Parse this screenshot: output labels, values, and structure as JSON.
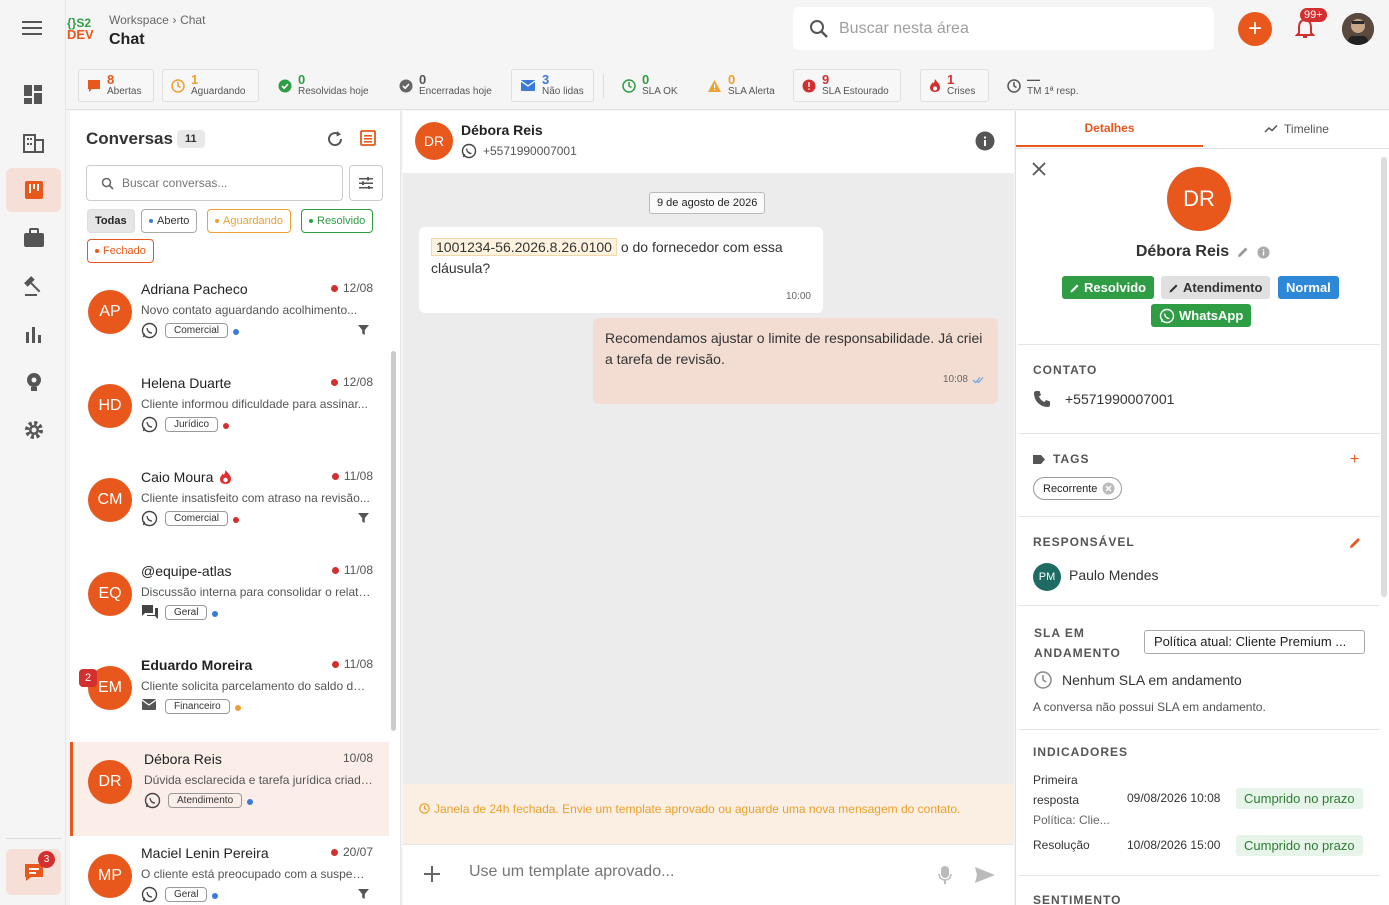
{
  "brand": {
    "logo_line1": "{}S2",
    "logo_line2": "DEV"
  },
  "header": {
    "breadcrumb_root": "Workspace",
    "breadcrumb_sep": "›",
    "breadcrumb_current": "Chat",
    "title": "Chat",
    "search_placeholder": "Buscar nesta área",
    "notif_count": "99+"
  },
  "rail": {
    "chat_badge": "3"
  },
  "stats": [
    {
      "num": "8",
      "label": "Abertas",
      "color": "#e8581c"
    },
    {
      "num": "1",
      "label": "Aguardando",
      "color": "#f0a030"
    },
    {
      "num": "0",
      "label": "Resolvidas hoje",
      "color": "#2e9d44"
    },
    {
      "num": "0",
      "label": "Encerradas hoje",
      "color": "#555555"
    },
    {
      "num": "3",
      "label": "Não lidas",
      "color": "#3a7bd5"
    },
    {
      "num": "0",
      "label": "SLA OK",
      "color": "#2e9d44"
    },
    {
      "num": "0",
      "label": "SLA Alerta",
      "color": "#f0a030"
    },
    {
      "num": "9",
      "label": "SLA Estourado",
      "color": "#d32f2f"
    },
    {
      "num": "1",
      "label": "Crises",
      "color": "#d32f2f"
    },
    {
      "num": "—",
      "label": "TM 1ª resp.",
      "color": "#555555"
    }
  ],
  "conversations": {
    "title": "Conversas",
    "count": "11",
    "search_placeholder": "Buscar conversas...",
    "filters": [
      "Todas",
      "Aberto",
      "Aguardando",
      "Resolvido",
      "Fechado"
    ],
    "items": [
      {
        "initials": "AP",
        "name": "Adriana Pacheco",
        "date": "12/08",
        "preview": "Novo contato aguardando acolhimento...",
        "tag": "Comercial",
        "dot": "#3a7bd5",
        "channel": "whatsapp"
      },
      {
        "initials": "HD",
        "name": "Helena Duarte",
        "date": "12/08",
        "preview": "Cliente informou dificuldade para assinar...",
        "tag": "Jurídico",
        "dot": "#d32f2f",
        "channel": "whatsapp"
      },
      {
        "initials": "CM",
        "name": "Caio Moura",
        "date": "11/08",
        "preview": "Cliente insatisfeito com atraso na revisão...",
        "tag": "Comercial",
        "dot": "#d32f2f",
        "channel": "whatsapp"
      },
      {
        "initials": "EQ",
        "name": "@equipe-atlas",
        "date": "11/08",
        "preview": "Discussão interna para consolidar o relatório...",
        "tag": "Geral",
        "dot": "#3a7bd5",
        "channel": "forum"
      },
      {
        "initials": "EM",
        "name": "Eduardo Moreira",
        "date": "11/08",
        "preview": "Cliente solicita parcelamento do saldo devedor...",
        "tag": "Financeiro",
        "dot": "#f0a030",
        "channel": "email",
        "unread": "2"
      },
      {
        "initials": "DR",
        "name": "Débora Reis",
        "date": "10/08",
        "preview": "Dúvida esclarecida e tarefa jurídica criada...",
        "tag": "Atendimento",
        "dot": "#3a7bd5",
        "channel": "whatsapp"
      },
      {
        "initials": "MP",
        "name": "Maciel Lenin Pereira",
        "date": "20/07",
        "preview": "O cliente está preocupado com a suspensão...",
        "tag": "Geral",
        "dot": "#3a7bd5",
        "channel": "whatsapp"
      }
    ]
  },
  "chat": {
    "contact_initials": "DR",
    "contact_name": "Débora Reis",
    "contact_phone": "+5571990007001",
    "date_divider": "9 de agosto de 2026",
    "msg_in_highlight": "1001234-56.2026.8.26.0100",
    "msg_in_rest": " o do fornecedor com essa cláusula?",
    "msg_in_time": "10:00",
    "msg_out_text": "Recomendamos ajustar o limite de responsabilidade. Já criei a tarefa de revisão.",
    "msg_out_time": "10:08",
    "warning": "Janela de 24h fechada. Envie um template aprovado ou aguarde uma nova mensagem do contato.",
    "composer_placeholder": "Use um template aprovado..."
  },
  "details": {
    "tab_details": "Detalhes",
    "tab_timeline": "Timeline",
    "initials": "DR",
    "name": "Débora Reis",
    "status_resolved": "Resolvido",
    "status_stage": "Atendimento",
    "priority": "Normal",
    "channel": "WhatsApp",
    "contact_title": "CONTATO",
    "phone": "+5571990007001",
    "tags_title": "TAGS",
    "tag": "Recorrente",
    "responsible_title": "RESPONSÁVEL",
    "responsible_initials": "PM",
    "responsible_name": "Paulo Mendes",
    "sla_title_1": "SLA EM",
    "sla_title_2": "ANDAMENTO",
    "sla_policy": "Política atual: Cliente Premium ...",
    "sla_none": "Nenhum SLA em andamento",
    "sla_desc": "A conversa não possui SLA em andamento.",
    "indicators_title": "INDICADORES",
    "ind1_label_1": "Primeira",
    "ind1_label_2": "resposta",
    "ind1_sub": "Política: Clie...",
    "ind1_date": "09/08/2026 10:08",
    "ind1_status": "Cumprido no prazo",
    "ind2_label": "Resolução",
    "ind2_date": "10/08/2026 15:00",
    "ind2_status": "Cumprido no prazo",
    "sentiment_title": "SENTIMENTO"
  },
  "colors": {
    "accent": "#e8581c",
    "success": "#2e9d44",
    "info": "#2d88d8",
    "danger": "#d32f2f"
  }
}
